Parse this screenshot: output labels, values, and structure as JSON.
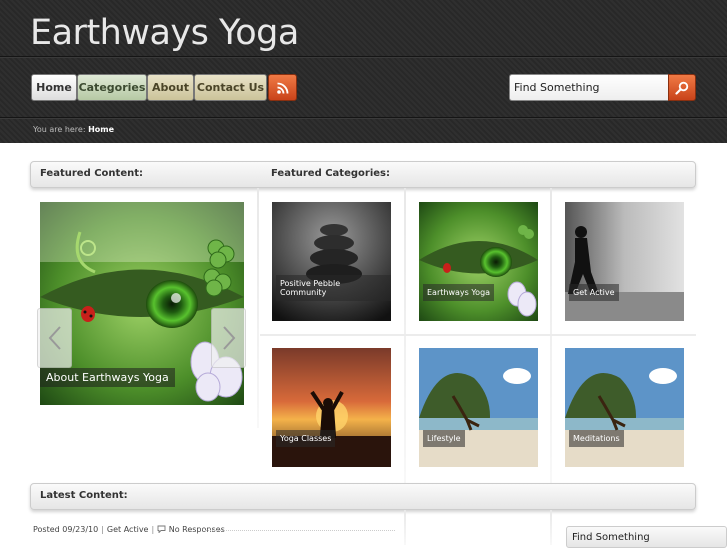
{
  "site": {
    "title": "Earthways Yoga"
  },
  "nav": {
    "items": [
      {
        "label": "Home"
      },
      {
        "label": "Categories"
      },
      {
        "label": "About"
      },
      {
        "label": "Contact Us"
      }
    ],
    "rss_icon": "rss-icon"
  },
  "search": {
    "value": "Find Something",
    "button_icon": "magnifier-icon"
  },
  "breadcrumb": {
    "prefix": "You are here:",
    "current": "Home"
  },
  "sections": {
    "featured_content": "Featured Content:",
    "featured_categories": "Featured Categories:",
    "latest_content": "Latest Content:"
  },
  "featured": {
    "caption": "About Earthways Yoga"
  },
  "categories": [
    {
      "label": "Positive Pebble Community"
    },
    {
      "label": "Earthways Yoga"
    },
    {
      "label": "Get Active"
    },
    {
      "label": "Yoga Classes"
    },
    {
      "label": "Lifestyle"
    },
    {
      "label": "Meditations"
    }
  ],
  "latest_post": {
    "posted": "Posted 09/23/10",
    "category": "Get Active",
    "responses": "No Responses"
  },
  "sidebar": {
    "search_title": "Find Something"
  },
  "colors": {
    "header_bg": "#2a2a2a",
    "accent_orange": "#d9531e",
    "categories_green": "#b6c9a4",
    "about_tan": "#cbc39a"
  }
}
